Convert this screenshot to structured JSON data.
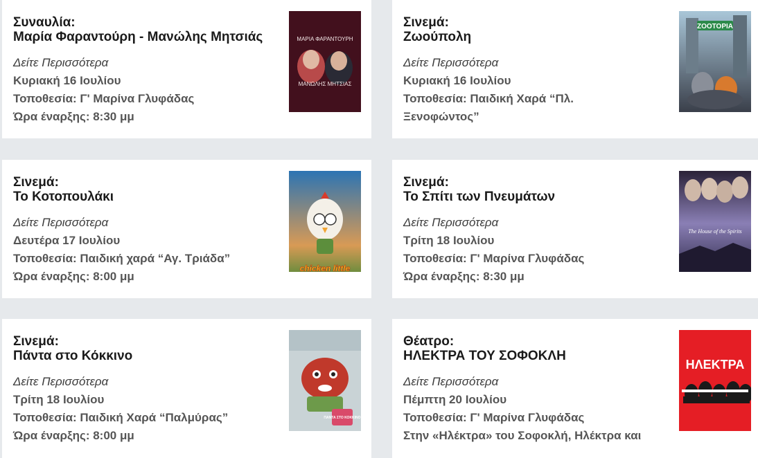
{
  "events": [
    {
      "category": "Συναυλία:",
      "title": "Μαρία Φαραντούρη - Μανώλης Μητσιάς",
      "more_label": "Δείτε Περισσότερα",
      "date": "Κυριακή 16 Ιουλίου",
      "location": "Τοποθεσία: Γ' Μαρίνα Γλυφάδας",
      "extra": "Ώρα έναρξης: 8:30 μμ",
      "poster": {
        "icon": "concert-poster-image",
        "top_text": "ΜΑΡΙΑ ΦΑΡΑΝΤΟΥΡΗ",
        "bottom_text": "ΜΑΝΩΛΗΣ ΜΗΤΣΙΑΣ",
        "bg": "#3a0f1a"
      }
    },
    {
      "category": "Σινεμά:",
      "title": "Ζωούπολη",
      "more_label": "Δείτε Περισσότερα",
      "date": "Κυριακή 16 Ιουλίου",
      "location": "Τοποθεσία: Παιδική Χαρά “Πλ. Ξενοφώντος”",
      "extra": "",
      "poster": {
        "icon": "zootopia-poster-image",
        "top_text": "ZOOTOPIA",
        "bottom_text": "",
        "bg": "#5a6b7a"
      }
    },
    {
      "category": "Σινεμά:",
      "title": "Το Κοτοπουλάκι",
      "more_label": "Δείτε Περισσότερα",
      "date": "Δευτέρα 17 Ιουλίου",
      "location": "Τοποθεσία: Παιδική χαρά “Αγ. Τριάδα”",
      "extra": "Ώρα έναρξης: 8:00 μμ",
      "poster": {
        "icon": "chicken-little-poster-image",
        "top_text": "",
        "bottom_text": "chicken little",
        "bg": "#3d8fc4"
      }
    },
    {
      "category": "Σινεμά:",
      "title": "Το Σπίτι των Πνευμάτων",
      "more_label": "Δείτε Περισσότερα",
      "date": "Τρίτη 18 Ιουλίου",
      "location": "Τοποθεσία: Γ' Μαρίνα Γλυφάδας",
      "extra": "Ώρα έναρξης: 8:30 μμ",
      "poster": {
        "icon": "house-of-spirits-poster-image",
        "top_text": "",
        "bottom_text": "The House of the Spirits",
        "bg": "#5b4c7e"
      }
    },
    {
      "category": "Σινεμά:",
      "title": "Πάντα στο Κόκκινο",
      "more_label": "Δείτε Περισσότερα",
      "date": "Τρίτη 18 Ιουλίου",
      "location": "Τοποθεσία: Παιδική Χαρά  “Παλμύρας”",
      "extra": "Ώρα έναρξης: 8:00 μμ",
      "poster": {
        "icon": "turning-red-poster-image",
        "top_text": "",
        "bottom_text": "ΠΑΝΤΑ ΣΤΟ ΚΟΚΚΙΝΟ",
        "bg": "#c9d3d6"
      }
    },
    {
      "category": "Θέατρο:",
      "title": "ΗΛΕΚΤΡΑ ΤΟΥ ΣΟΦΟΚΛΗ",
      "more_label": "Δείτε Περισσότερα",
      "date": "Πέμπτη 20 Ιουλίου",
      "location": "Τοποθεσία: Γ' Μαρίνα Γλυφάδας",
      "extra": "Στην «Ηλέκτρα» του Σοφοκλή, Ηλέκτρα και",
      "poster": {
        "icon": "electra-poster-image",
        "top_text": "ΗΛΕΚΤΡΑ",
        "bottom_text": "",
        "bg": "#e51e25"
      }
    }
  ]
}
